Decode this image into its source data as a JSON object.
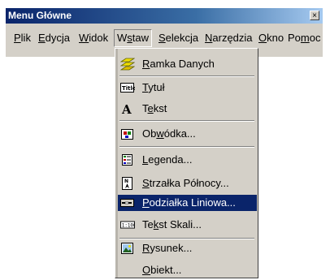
{
  "window": {
    "title": "Menu Główne",
    "close_glyph": "×"
  },
  "menubar": {
    "items": [
      {
        "pre": "",
        "key": "P",
        "post": "lik"
      },
      {
        "pre": "",
        "key": "E",
        "post": "dycja"
      },
      {
        "pre": "",
        "key": "W",
        "post": "idok"
      },
      {
        "pre": "W",
        "key": "s",
        "post": "taw"
      },
      {
        "pre": "",
        "key": "S",
        "post": "elekcja"
      },
      {
        "pre": "",
        "key": "N",
        "post": "arzędzia"
      },
      {
        "pre": "",
        "key": "O",
        "post": "kno"
      },
      {
        "pre": "Po",
        "key": "m",
        "post": "oc"
      }
    ]
  },
  "dropdown": {
    "items": [
      {
        "pre": "",
        "key": "R",
        "post": "amka Danych",
        "icon": "frame-data-icon"
      },
      {
        "pre": "",
        "key": "T",
        "post": "ytuł",
        "icon": "title-icon"
      },
      {
        "pre": "T",
        "key": "e",
        "post": "kst",
        "icon": "text-icon"
      },
      {
        "pre": "Ob",
        "key": "w",
        "post": "ódka...",
        "icon": "border-icon"
      },
      {
        "pre": "",
        "key": "L",
        "post": "egenda...",
        "icon": "legend-icon"
      },
      {
        "pre": "",
        "key": "S",
        "post": "trzałka Północy...",
        "icon": "north-arrow-icon"
      },
      {
        "pre": "",
        "key": "P",
        "post": "odziałka Liniowa...",
        "icon": "scale-bar-icon"
      },
      {
        "pre": "Te",
        "key": "k",
        "post": "st Skali...",
        "icon": "scale-text-icon"
      },
      {
        "pre": "",
        "key": "R",
        "post": "ysunek...",
        "icon": "picture-icon"
      },
      {
        "pre": "",
        "key": "O",
        "post": "biekt...",
        "icon": ""
      }
    ]
  },
  "colors": {
    "highlight": "#0a246a",
    "face": "#d4d0c8"
  }
}
